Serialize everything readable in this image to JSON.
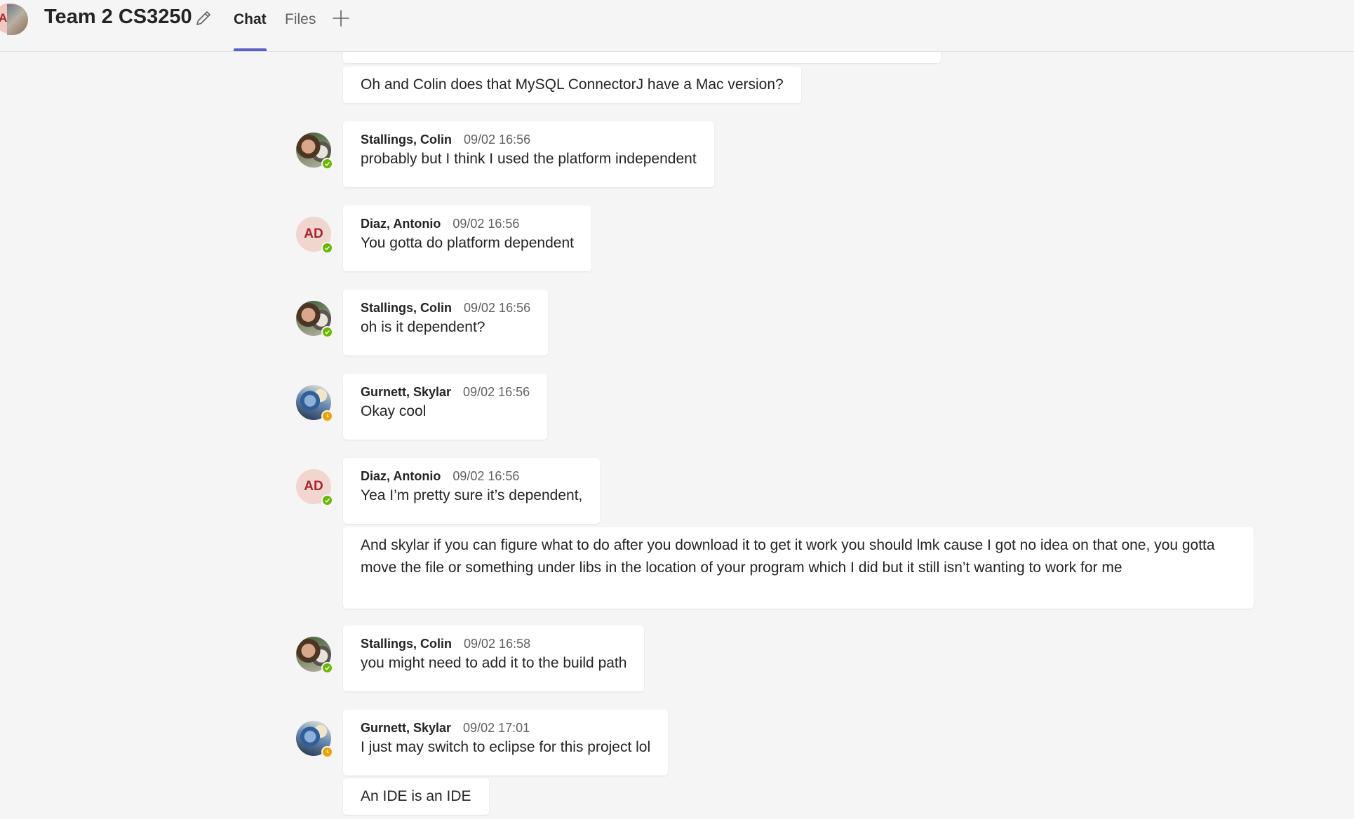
{
  "header": {
    "group_avatar_initial": "A",
    "title": "Team 2 CS3250",
    "tabs": [
      {
        "label": "Chat",
        "active": true
      },
      {
        "label": "Files",
        "active": false
      }
    ],
    "accent_color": "#5b5fc7"
  },
  "messages": [
    {
      "type": "continuation",
      "text": "Oh and Colin does that MySQL ConnectorJ have a Mac version?"
    },
    {
      "type": "message",
      "sender": "Stallings, Colin",
      "time": "09/02 16:56",
      "text": "probably but I think I used the platform independent",
      "avatar": "photo",
      "status": "available"
    },
    {
      "type": "message",
      "sender": "Diaz, Antonio",
      "time": "09/02 16:56",
      "text": "You gotta do platform dependent",
      "avatar_initials": "AD",
      "status": "available"
    },
    {
      "type": "message",
      "sender": "Stallings, Colin",
      "time": "09/02 16:56",
      "text": "oh is it dependent?",
      "avatar": "photo",
      "status": "available"
    },
    {
      "type": "message",
      "sender": "Gurnett, Skylar",
      "time": "09/02 16:56",
      "text": "Okay cool",
      "avatar": "photo",
      "status": "away"
    },
    {
      "type": "message",
      "sender": "Diaz, Antonio",
      "time": "09/02 16:56",
      "text": "Yea I’m pretty sure it’s dependent,",
      "avatar_initials": "AD",
      "status": "available"
    },
    {
      "type": "continuation",
      "text": "And skylar if you can figure what to do after you download it to get it work you should lmk cause I got no idea on that one, you gotta move the file or something under libs in the location of your program which I did but it still isn’t wanting to work for me"
    },
    {
      "type": "message",
      "sender": "Stallings, Colin",
      "time": "09/02 16:58",
      "text": "you might need to add it to the build path",
      "avatar": "photo",
      "status": "available"
    },
    {
      "type": "message",
      "sender": "Gurnett, Skylar",
      "time": "09/02 17:01",
      "text": "I just may switch to eclipse for this project lol",
      "avatar": "photo",
      "status": "away"
    },
    {
      "type": "continuation",
      "text": "An IDE is an IDE"
    }
  ]
}
